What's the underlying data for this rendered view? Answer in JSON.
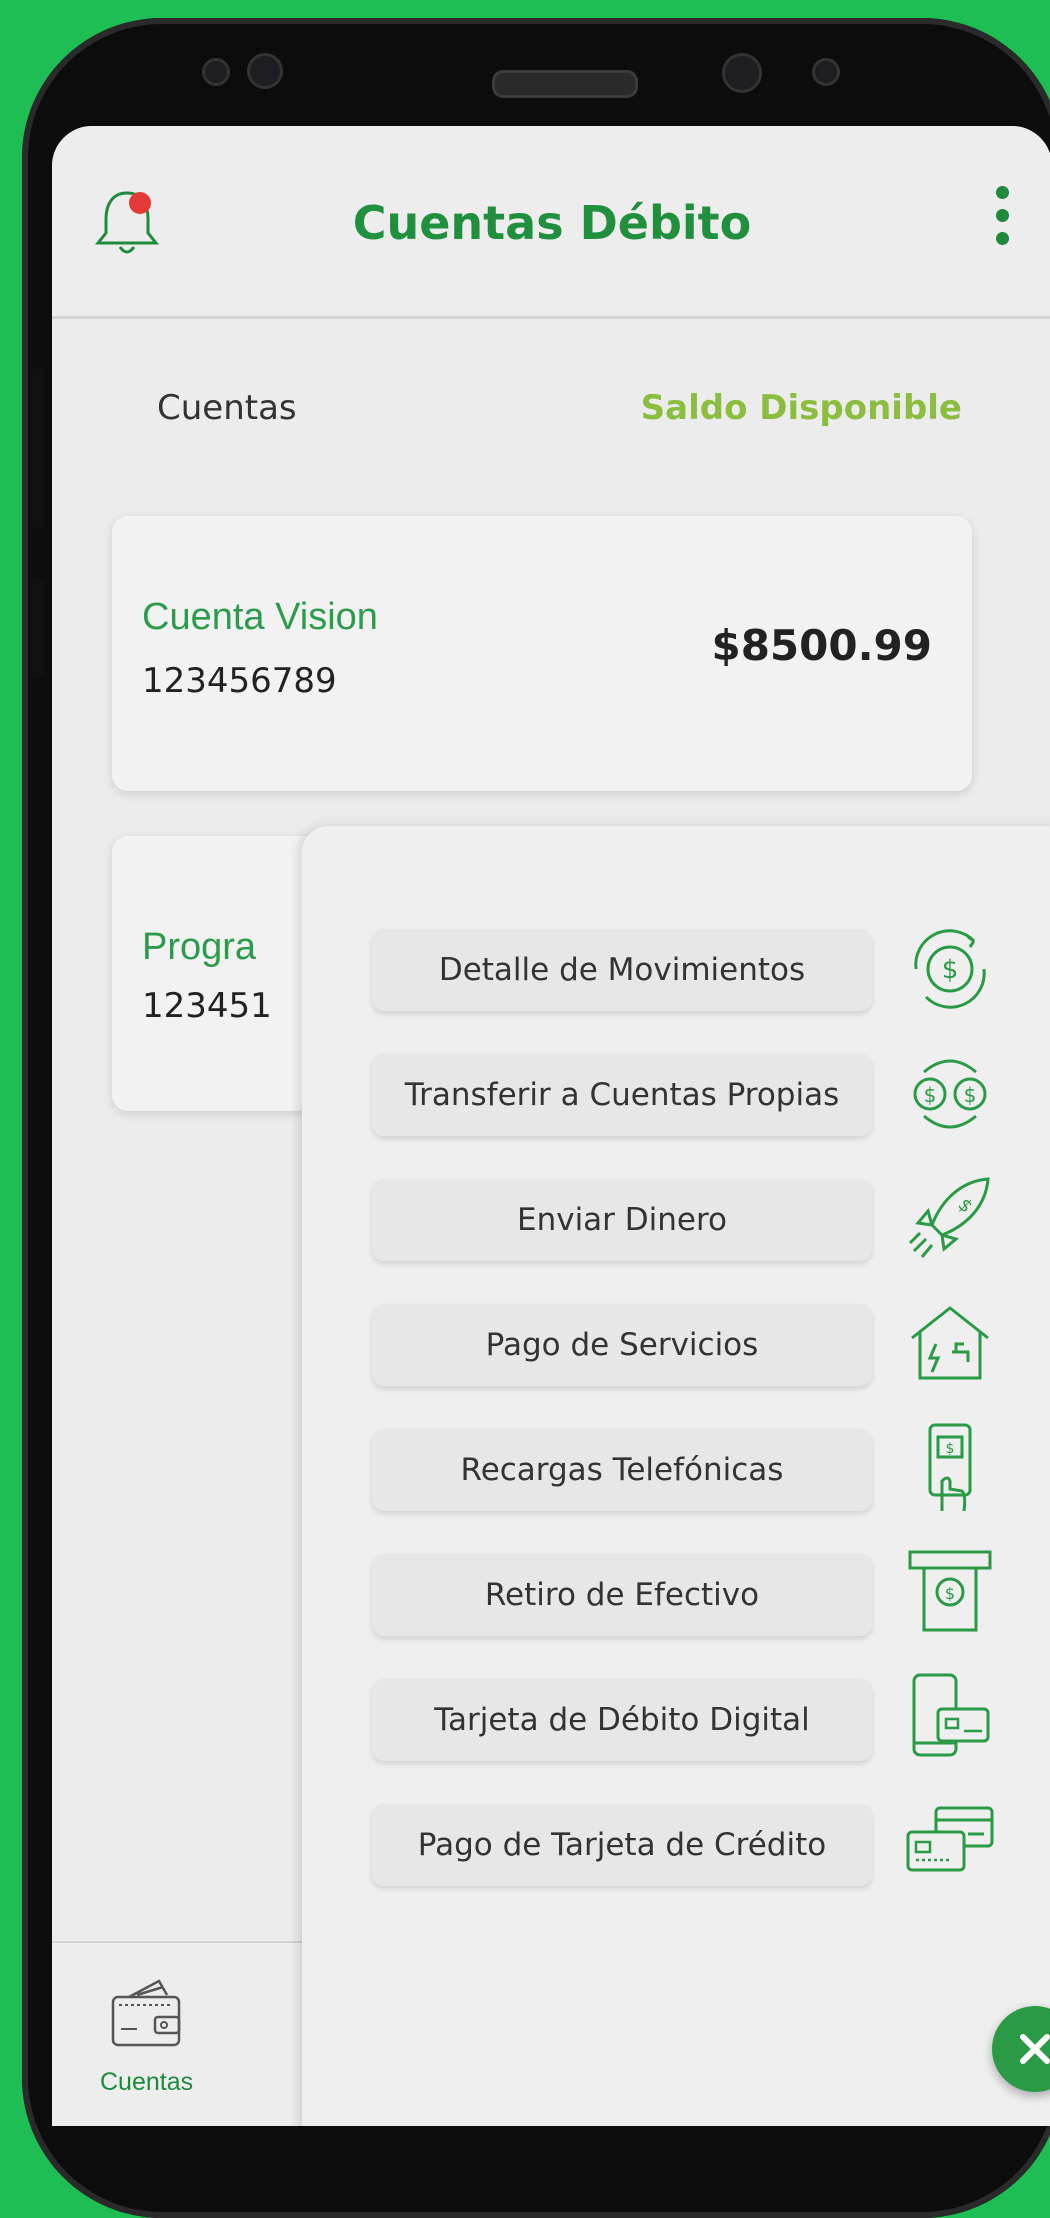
{
  "header": {
    "title": "Cuentas Débito",
    "bell_icon": "bell-icon",
    "menu_icon": "kebab-menu-icon",
    "notification_color": "#e53935"
  },
  "labels": {
    "accounts": "Cuentas",
    "balance": "Saldo Disponible"
  },
  "accounts": [
    {
      "name": "Cuenta Vision",
      "number": "123456789",
      "balance": "$8500.99"
    },
    {
      "name": "Progra",
      "number": "123451"
    }
  ],
  "menu": {
    "items": [
      {
        "label": "Detalle de Movimientos",
        "icon": "money-cycle-icon"
      },
      {
        "label": "Transferir a Cuentas Propias",
        "icon": "transfer-icon"
      },
      {
        "label": "Enviar Dinero",
        "icon": "rocket-icon"
      },
      {
        "label": "Pago de Servicios",
        "icon": "house-services-icon"
      },
      {
        "label": "Recargas Telefónicas",
        "icon": "phone-recharge-icon"
      },
      {
        "label": "Retiro de Efectivo",
        "icon": "atm-cash-icon"
      },
      {
        "label": "Tarjeta de Débito Digital",
        "icon": "digital-card-icon"
      },
      {
        "label": "Pago de Tarjeta de Crédito",
        "icon": "credit-card-icon"
      }
    ]
  },
  "bottom_nav": {
    "label": "Cuentas",
    "icon": "wallet-icon"
  },
  "close_button": {
    "icon": "close-icon"
  },
  "colors": {
    "brand_green": "#21903e",
    "accent_lime": "#8bbd3f",
    "background_green": "#1ebe54"
  }
}
